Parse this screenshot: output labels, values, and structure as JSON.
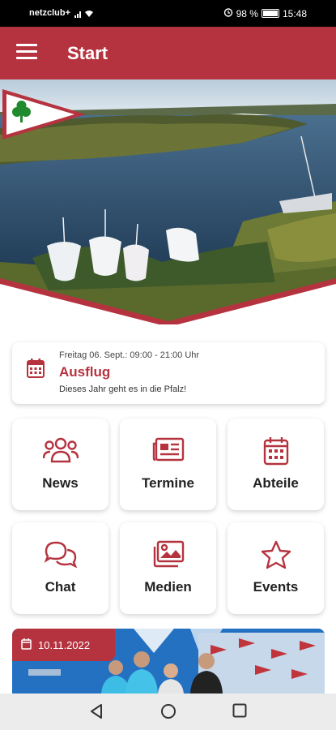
{
  "status_bar": {
    "carrier": "netzclub+",
    "battery": "98 %",
    "time": "15:48"
  },
  "app_bar": {
    "title": "Start"
  },
  "event": {
    "date": "Freitag 06. Sept.: 09:00 - 21:00 Uhr",
    "title": "Ausflug",
    "description": "Dieses Jahr geht es in die Pfalz!"
  },
  "tiles": [
    {
      "label": "News",
      "icon": "users-icon"
    },
    {
      "label": "Termine",
      "icon": "newspaper-icon"
    },
    {
      "label": "Abteile",
      "icon": "calendar-icon"
    },
    {
      "label": "Chat",
      "icon": "chat-icon"
    },
    {
      "label": "Medien",
      "icon": "images-icon"
    },
    {
      "label": "Events",
      "icon": "star-icon"
    }
  ],
  "news": {
    "date": "10.11.2022"
  },
  "colors": {
    "brand": "#b5333f",
    "flag_green": "#1f8a2e"
  }
}
